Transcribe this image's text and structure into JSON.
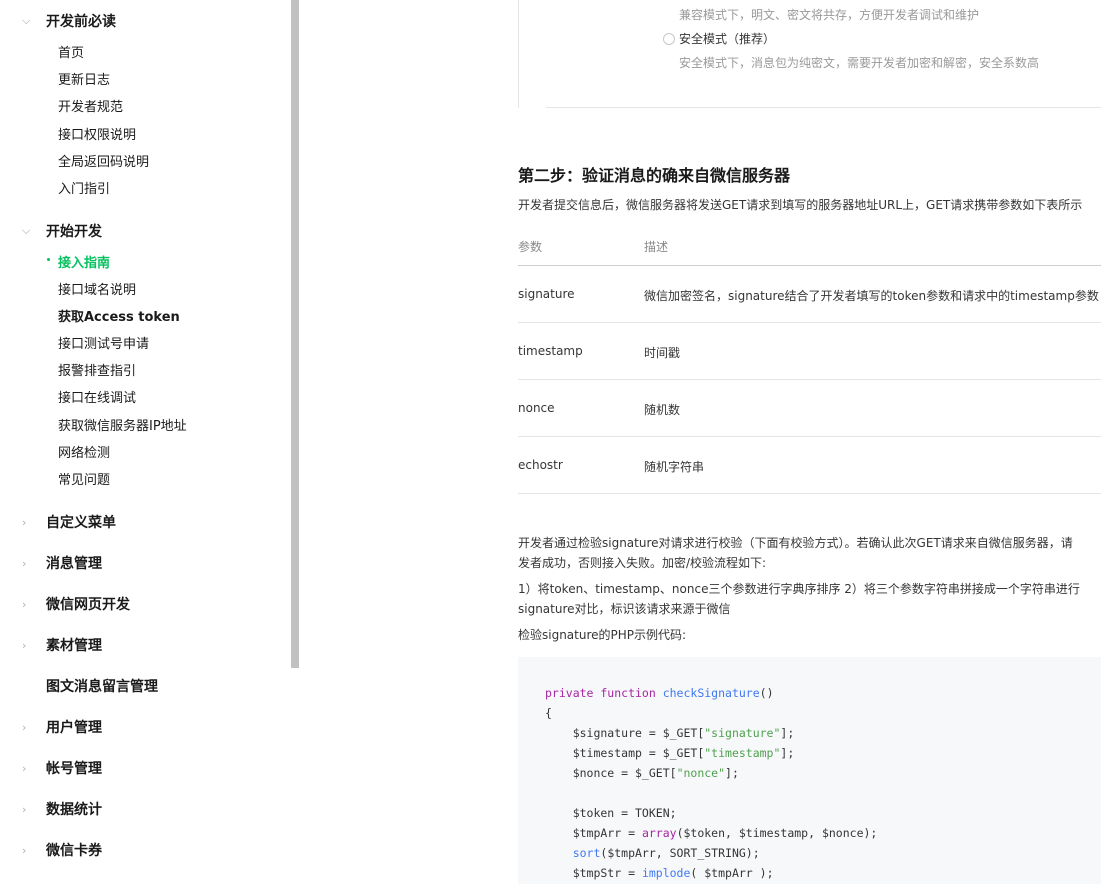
{
  "sidebar": {
    "groups": [
      {
        "label": "开发前必读",
        "chevron": "chevron-down-icon",
        "items": [
          "首页",
          "更新日志",
          "开发者规范",
          "接口权限说明",
          "全局返回码说明",
          "入门指引"
        ]
      },
      {
        "label": "开始开发",
        "chevron": "chevron-down-icon",
        "items": [
          "接入指南",
          "接口域名说明",
          "获取Access token",
          "接口测试号申请",
          "报警排查指引",
          "接口在线调试",
          "获取微信服务器IP地址",
          "网络检测",
          "常见问题"
        ]
      },
      {
        "label": "自定义菜单",
        "chevron": "chevron-right-icon"
      },
      {
        "label": "消息管理",
        "chevron": "chevron-right-icon"
      },
      {
        "label": "微信网页开发",
        "chevron": "chevron-right-icon"
      },
      {
        "label": "素材管理",
        "chevron": "chevron-right-icon"
      },
      {
        "label": "图文消息留言管理"
      },
      {
        "label": "用户管理",
        "chevron": "chevron-right-icon"
      },
      {
        "label": "帐号管理",
        "chevron": "chevron-right-icon"
      },
      {
        "label": "数据统计",
        "chevron": "chevron-right-icon"
      },
      {
        "label": "微信卡券",
        "chevron": "chevron-right-icon"
      }
    ],
    "active_item": "接入指南",
    "accent_color": "#07c160"
  },
  "main": {
    "compat_hint": "兼容模式下，明文、密文将共存，方便开发者调试和维护",
    "safe_mode_label": "安全模式（推荐）",
    "safe_mode_hint": "安全模式下，消息包为纯密文，需要开发者加密和解密，安全系数高",
    "step2_title": "第二步：验证消息的确来自微信服务器",
    "step2_intro": "开发者提交信息后，微信服务器将发送GET请求到填写的服务器地址URL上，GET请求携带参数如下表所示",
    "table": {
      "headers": [
        "参数",
        "描述"
      ],
      "rows": [
        [
          "signature",
          "微信加密签名，signature结合了开发者填写的token参数和请求中的timestamp参数"
        ],
        [
          "timestamp",
          "时间戳"
        ],
        [
          "nonce",
          "随机数"
        ],
        [
          "echostr",
          "随机字符串"
        ]
      ]
    },
    "verify_p1_line1": "开发者通过检验signature对请求进行校验（下面有校验方式）。若确认此次GET请求来自微信服务器，请",
    "verify_p1_line2": "发者成功，否则接入失败。加密/校验流程如下:",
    "verify_p2_line1": "1）将token、timestamp、nonce三个参数进行字典序排序 2）将三个参数字符串拼接成一个字符串进行",
    "verify_p2_line2": "signature对比，标识该请求来源于微信",
    "php_caption": "检验signature的PHP示例代码:",
    "code": {
      "l1_kw": "private function ",
      "l1_fn": "checkSignature",
      "l1_rest": "()",
      "l2": "{",
      "l3_a": "    $signature = $_GET[",
      "l3_s": "\"signature\"",
      "l3_b": "];",
      "l4_a": "    $timestamp = $_GET[",
      "l4_s": "\"timestamp\"",
      "l4_b": "];",
      "l5_a": "    $nonce = $_GET[",
      "l5_s": "\"nonce\"",
      "l5_b": "];",
      "l7": "    $token = TOKEN;",
      "l8_a": "    $tmpArr = ",
      "l8_k": "array",
      "l8_b": "($token, $timestamp, $nonce);",
      "l9_f": "    sort",
      "l9_b": "($tmpArr, SORT_STRING);",
      "l10_a": "    $tmpStr = ",
      "l10_f": "implode",
      "l10_b": "( $tmpArr );"
    }
  }
}
